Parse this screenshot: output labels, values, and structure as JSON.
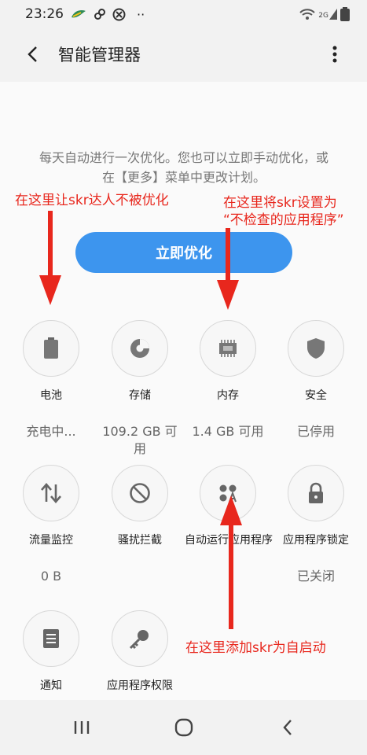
{
  "status_bar": {
    "time": "23:26",
    "icons": [
      "leaf-icon",
      "link-icon",
      "blocked-icon",
      "more-dots-icon",
      "wifi-icon",
      "signal-icon",
      "battery-icon"
    ],
    "dots": "··",
    "network_label": "2G"
  },
  "app_bar": {
    "title": "智能管理器",
    "back_icon": "back-arrow-icon",
    "more_icon": "more-vert-icon"
  },
  "description": "每天自动进行一次优化。您也可以立即手动优化，或在【更多】菜单中更改计划。",
  "optimize_button": "立即优化",
  "tiles": [
    {
      "label": "电池",
      "value": "充电中...",
      "icon": "battery-icon"
    },
    {
      "label": "存储",
      "value": "109.2 GB 可用",
      "icon": "storage-pie-icon"
    },
    {
      "label": "内存",
      "value": "1.4 GB 可用",
      "icon": "memory-chip-icon"
    },
    {
      "label": "安全",
      "value": "已停用",
      "icon": "shield-icon"
    },
    {
      "label": "流量监控",
      "value": "0 B",
      "icon": "data-arrows-icon"
    },
    {
      "label": "骚扰拦截",
      "value": "",
      "icon": "block-icon"
    },
    {
      "label": "自动运行应用程序",
      "value": "",
      "icon": "apps-auto-icon"
    },
    {
      "label": "应用程序锁定",
      "value": "已关闭",
      "icon": "lock-icon"
    },
    {
      "label": "通知",
      "value": "",
      "icon": "notification-icon"
    },
    {
      "label": "应用程序权限",
      "value": "",
      "icon": "key-icon"
    }
  ],
  "annotations": {
    "battery": "在这里让skr达人不被优化",
    "memory_line1": "在这里将skr设置为",
    "memory_line2": "“不检查的应用程序”",
    "autorun": "在这里添加skr为自启动",
    "color": "#e8271d"
  },
  "nav_bar": {
    "icons": [
      "recents-icon",
      "home-icon",
      "back-icon"
    ]
  },
  "colors": {
    "accent": "#3d95ee",
    "background": "#f2f2f2",
    "annotation": "#e8271d"
  }
}
